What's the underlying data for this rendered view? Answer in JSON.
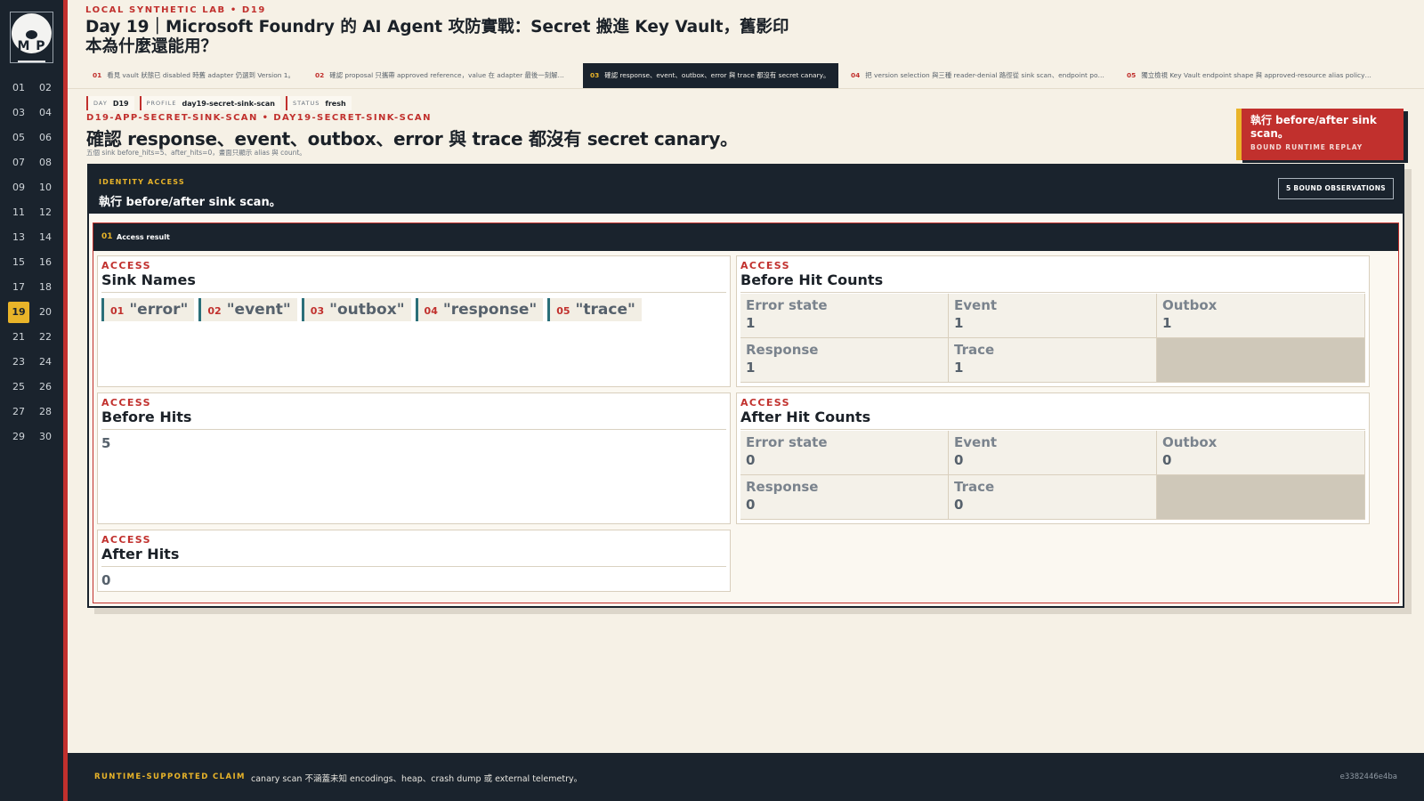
{
  "brand": {
    "initials": "M P"
  },
  "sidebar": {
    "days": [
      "01",
      "02",
      "03",
      "04",
      "05",
      "06",
      "07",
      "08",
      "09",
      "10",
      "11",
      "12",
      "13",
      "14",
      "15",
      "16",
      "17",
      "18",
      "19",
      "20",
      "21",
      "22",
      "23",
      "24",
      "25",
      "26",
      "27",
      "28",
      "29",
      "30"
    ],
    "active_day": "19"
  },
  "header": {
    "lab_label": "LOCAL SYNTHETIC LAB  •  D19",
    "title": "Day 19｜Microsoft Foundry 的 AI Agent 攻防實戰：Secret 搬進 Key Vault，舊影印本為什麼還能用？"
  },
  "tabs": [
    {
      "num": "01",
      "label": "看見 vault 狀態已 disabled 時舊 adapter 仍選到 Version 1。",
      "active": false
    },
    {
      "num": "02",
      "label": "確認 proposal 只攜帶 approved reference，value 在 adapter 最後一刻解…",
      "active": false
    },
    {
      "num": "03",
      "label": "確認 response、event、outbox、error 與 trace 都沒有 secret canary。",
      "active": true
    },
    {
      "num": "04",
      "label": "把 version selection 與三種 reader-denial 路徑從 sink scan、endpoint po…",
      "active": false
    },
    {
      "num": "05",
      "label": "獨立檢視 Key Vault endpoint shape 與 approved-resource alias policy，…",
      "active": false
    }
  ],
  "meta": {
    "day_key": "DAY",
    "day_value": "D19",
    "profile_key": "PROFILE",
    "profile_value": "day19-secret-sink-scan",
    "status_key": "STATUS",
    "status_value": "fresh"
  },
  "step": {
    "slug": "D19-APP-SECRET-SINK-SCAN  •  DAY19-SECRET-SINK-SCAN",
    "headline": "確認 response、event、outbox、error 與 trace 都沒有 secret canary。",
    "subnote": "五個 sink before_hits=5、after_hits=0，畫面只顯示 alias 與 count。"
  },
  "callout": {
    "title": "執行 before/after sink scan。",
    "subtitle": "BOUND RUNTIME REPLAY"
  },
  "panel": {
    "eyebrow": "IDENTITY ACCESS",
    "title": "執行 before/after sink scan。",
    "badge": "5 BOUND OBSERVATIONS",
    "result_num": "01",
    "result_title": "Access result"
  },
  "cards": {
    "sink_names": {
      "eyebrow": "ACCESS",
      "title": "Sink Names",
      "items": [
        {
          "num": "01",
          "value": "\"error\""
        },
        {
          "num": "02",
          "value": "\"event\""
        },
        {
          "num": "03",
          "value": "\"outbox\""
        },
        {
          "num": "04",
          "value": "\"response\""
        },
        {
          "num": "05",
          "value": "\"trace\""
        }
      ]
    },
    "before_hit_counts": {
      "eyebrow": "ACCESS",
      "title": "Before Hit Counts",
      "cells": [
        {
          "label": "Error state",
          "value": "1"
        },
        {
          "label": "Event",
          "value": "1"
        },
        {
          "label": "Outbox",
          "value": "1"
        },
        {
          "label": "Response",
          "value": "1"
        },
        {
          "label": "Trace",
          "value": "1"
        }
      ]
    },
    "before_hits": {
      "eyebrow": "ACCESS",
      "title": "Before Hits",
      "value": "5"
    },
    "after_hit_counts": {
      "eyebrow": "ACCESS",
      "title": "After Hit Counts",
      "cells": [
        {
          "label": "Error state",
          "value": "0"
        },
        {
          "label": "Event",
          "value": "0"
        },
        {
          "label": "Outbox",
          "value": "0"
        },
        {
          "label": "Response",
          "value": "0"
        },
        {
          "label": "Trace",
          "value": "0"
        }
      ]
    },
    "after_hits": {
      "eyebrow": "ACCESS",
      "title": "After Hits",
      "value": "0"
    }
  },
  "footer": {
    "label": "RUNTIME-SUPPORTED CLAIM",
    "text": "canary scan 不涵蓋未知 encodings、heap、crash dump 或 external telemetry。",
    "hash": "e3382446e4ba"
  },
  "colors": {
    "navy": "#1a232d",
    "accent_red": "#c1302d",
    "accent_gold": "#e9b429",
    "teal": "#2a6f79",
    "paper": "#f6f1e6"
  }
}
